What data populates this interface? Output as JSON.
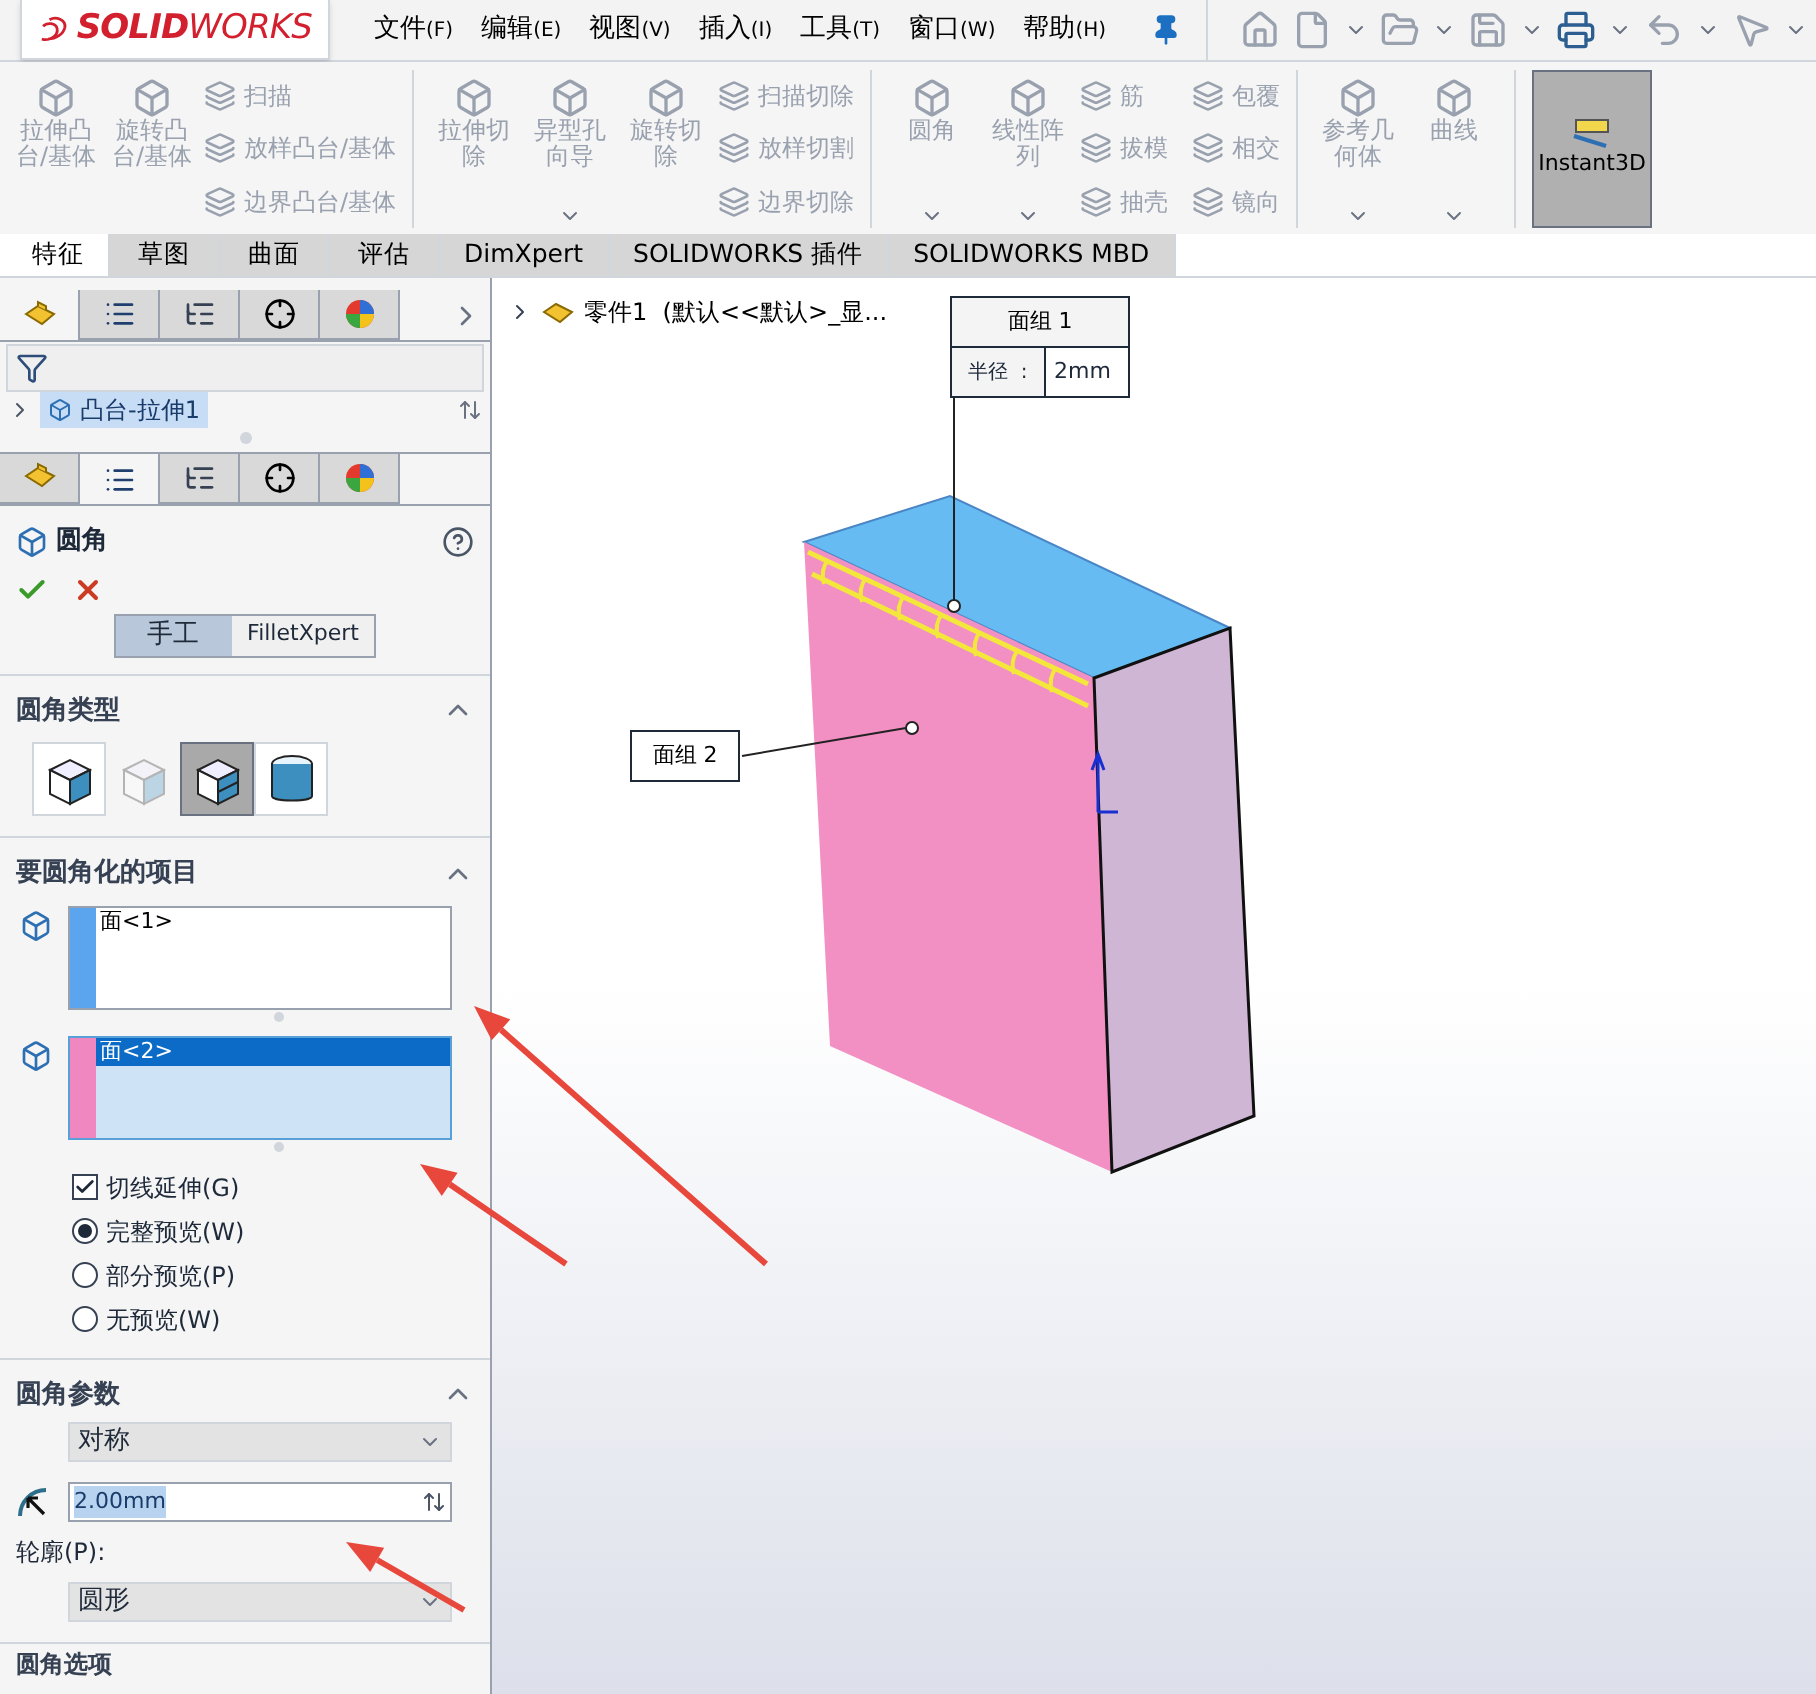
{
  "title_bar": {
    "logo": "**SOLID**WORKS",
    "menu": [
      {
        "label": "文件",
        "accel": "(F)"
      },
      {
        "label": "编辑",
        "accel": "(E)"
      },
      {
        "label": "视图",
        "accel": "(V)"
      },
      {
        "label": "插入",
        "accel": "(I)"
      },
      {
        "label": "工具",
        "accel": "(T)"
      },
      {
        "label": "窗口",
        "accel": "(W)"
      },
      {
        "label": "帮助",
        "accel": "(H)"
      }
    ]
  },
  "ribbon": {
    "groups": [
      {
        "large": [
          {
            "label": "拉伸凸台/基体",
            "dropdown": false
          },
          {
            "label": "旋转凸台/基体",
            "dropdown": false
          }
        ],
        "small": [
          {
            "label": "扫描"
          },
          {
            "label": "放样凸台/基体"
          },
          {
            "label": "边界凸台/基体"
          }
        ]
      },
      {
        "large": [
          {
            "label": "拉伸切除",
            "dropdown": false
          },
          {
            "label": "异型孔向导",
            "dropdown": true
          },
          {
            "label": "旋转切除",
            "dropdown": false
          }
        ],
        "small": [
          {
            "label": "扫描切除"
          },
          {
            "label": "放样切割"
          },
          {
            "label": "边界切除"
          }
        ]
      },
      {
        "large": [
          {
            "label": "圆角",
            "dropdown": true
          },
          {
            "label": "线性阵列",
            "dropdown": true
          }
        ],
        "small": [
          {
            "label": "筋"
          },
          {
            "label": "拔模"
          },
          {
            "label": "抽壳"
          },
          {
            "label": "包覆"
          },
          {
            "label": "相交"
          },
          {
            "label": "镜向"
          }
        ]
      },
      {
        "large": [
          {
            "label": "参考几何体",
            "dropdown": true
          },
          {
            "label": "曲线",
            "dropdown": true
          }
        ]
      }
    ],
    "instant3d": {
      "label": "Instant3D",
      "selected": true
    }
  },
  "command_tabs": [
    {
      "label": "特征",
      "selected": true
    },
    {
      "label": "草图",
      "selected": false
    },
    {
      "label": "曲面",
      "selected": false
    },
    {
      "label": "评估",
      "selected": false
    },
    {
      "label": "DimXpert",
      "selected": false
    },
    {
      "label": "SOLIDWORKS 插件",
      "selected": false
    },
    {
      "label": "SOLIDWORKS MBD",
      "selected": false
    }
  ],
  "feature_tree": {
    "manager_tabs": [
      {
        "selected": true
      },
      {
        "selected": false
      },
      {
        "selected": false
      },
      {
        "selected": false
      },
      {
        "selected": false
      }
    ],
    "items": [
      {
        "label": "凸台-拉伸1",
        "selected": true
      }
    ]
  },
  "property_manager": {
    "manager_tabs": [
      {
        "selected": false
      },
      {
        "selected": true
      },
      {
        "selected": false
      },
      {
        "selected": false
      },
      {
        "selected": false
      }
    ],
    "title": "圆角",
    "modes": [
      {
        "label": "手工",
        "selected": true
      },
      {
        "label": "FilletXpert",
        "selected": false
      }
    ],
    "fillet_type": {
      "title": "圆角类型",
      "options": [
        {
          "selected": false,
          "disabled": false
        },
        {
          "selected": false,
          "disabled": true
        },
        {
          "selected": true,
          "disabled": false
        },
        {
          "selected": false,
          "disabled": false
        }
      ]
    },
    "items": {
      "title": "要圆角化的项目",
      "lists": [
        {
          "color": "#5aa5ee",
          "selected": false,
          "entries": [
            {
              "label": "面<1>",
              "selected": false
            }
          ]
        },
        {
          "color": "#f087c0",
          "selected": true,
          "entries": [
            {
              "label": "面<2>",
              "selected": true
            }
          ]
        }
      ],
      "tangent": {
        "label": "切线延伸(G)",
        "checked": true
      },
      "preview": [
        {
          "label": "完整预览(W)",
          "selected": true
        },
        {
          "label": "部分预览(P)",
          "selected": false
        },
        {
          "label": "无预览(W)",
          "selected": false
        }
      ]
    },
    "params": {
      "title": "圆角参数",
      "method": "对称",
      "radius": "2.00mm",
      "profile_label": "轮廓(P):",
      "profile": "圆形"
    },
    "options_title": "圆角选项"
  },
  "viewport": {
    "breadcrumb": "零件1  (默认<<默认>_显...",
    "callouts": [
      {
        "title": "面组 1",
        "label": "半径  :",
        "value": "2mm"
      },
      {
        "title": "面组 2"
      }
    ]
  }
}
